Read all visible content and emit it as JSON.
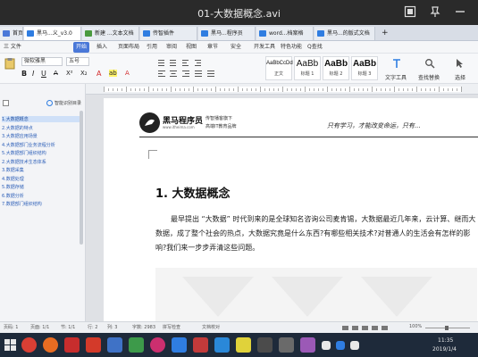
{
  "player": {
    "title": "01-大数据概念.avi"
  },
  "tabs": [
    {
      "label": "首页",
      "color": "#4a78d8"
    },
    {
      "label": "黑马...义_v3.0",
      "color": "#2f7de1"
    },
    {
      "label": "新建 ...文本文档",
      "color": "#4a9a3f"
    },
    {
      "label": "传智插件",
      "color": "#2f7de1"
    },
    {
      "label": "黑马...程序员",
      "color": "#2f7de1"
    },
    {
      "label": "word...档案格",
      "color": "#2f7de1"
    },
    {
      "label": "黑马...的版式文档",
      "color": "#2f7de1"
    }
  ],
  "menu": {
    "items": [
      "三 文件",
      "开始",
      "插入",
      "页面布局",
      "引用",
      "审阅",
      "视图",
      "章节",
      "安全",
      "开发工具",
      "特色功能",
      "Q查找"
    ],
    "active_index": 1
  },
  "ribbon": {
    "font_name": "微软雅黑",
    "font_size": "五号",
    "styles": [
      {
        "sample": "AaBbCcDd",
        "name": "正文"
      },
      {
        "sample": "AaBb",
        "name": "标题 1"
      },
      {
        "sample": "AaBb",
        "name": "标题 2"
      },
      {
        "sample": "AaBb",
        "name": "标题 3"
      }
    ],
    "text_tools": "文字工具",
    "find_replace": "查找替换",
    "select": "选择"
  },
  "navpane": {
    "header": "智能识别目录",
    "items": [
      "1.大数据概念",
      "2.大数据的特点",
      "3.大数据应用场景",
      "4.大数据部门业务流程分析",
      "5.大数据部门组织结构",
      "2.大数据技术生态体系",
      "3.数据采集",
      "4.数据处理",
      "5.数据存储",
      "6.数据分析",
      "7.数据部门组织结构"
    ],
    "selected_index": 0
  },
  "document": {
    "logo_name": "黑马程序员",
    "logo_url": "www.itheima.com",
    "logo_tagline1": "传智播客旗下",
    "logo_tagline2": "高端IT教育品牌",
    "slogan": "只有学习，才能改变命运，只有...",
    "heading": "1. 大数据概念",
    "paragraph": "最早提出 “大数据” 时代到来的是全球知名咨询公司麦肯锡，大数据最近几年来，云计算、继而大数据，成了整个社会的热点，大数据究竟是什么东西?有哪些相关技术?对普通人的生活会有怎样的影响?我们来一步步弄清这些问题。"
  },
  "status": {
    "page": "页码: 1",
    "pages": "页面: 1/1",
    "section": "节: 1/1",
    "row": "行: 2",
    "col": "列: 3",
    "words": "字数: 2983",
    "spell": "拼写检查",
    "doc_check": "文档校对",
    "zoom": "100%"
  },
  "taskbar": {
    "time": "11:35",
    "date": "2019/1/4"
  }
}
